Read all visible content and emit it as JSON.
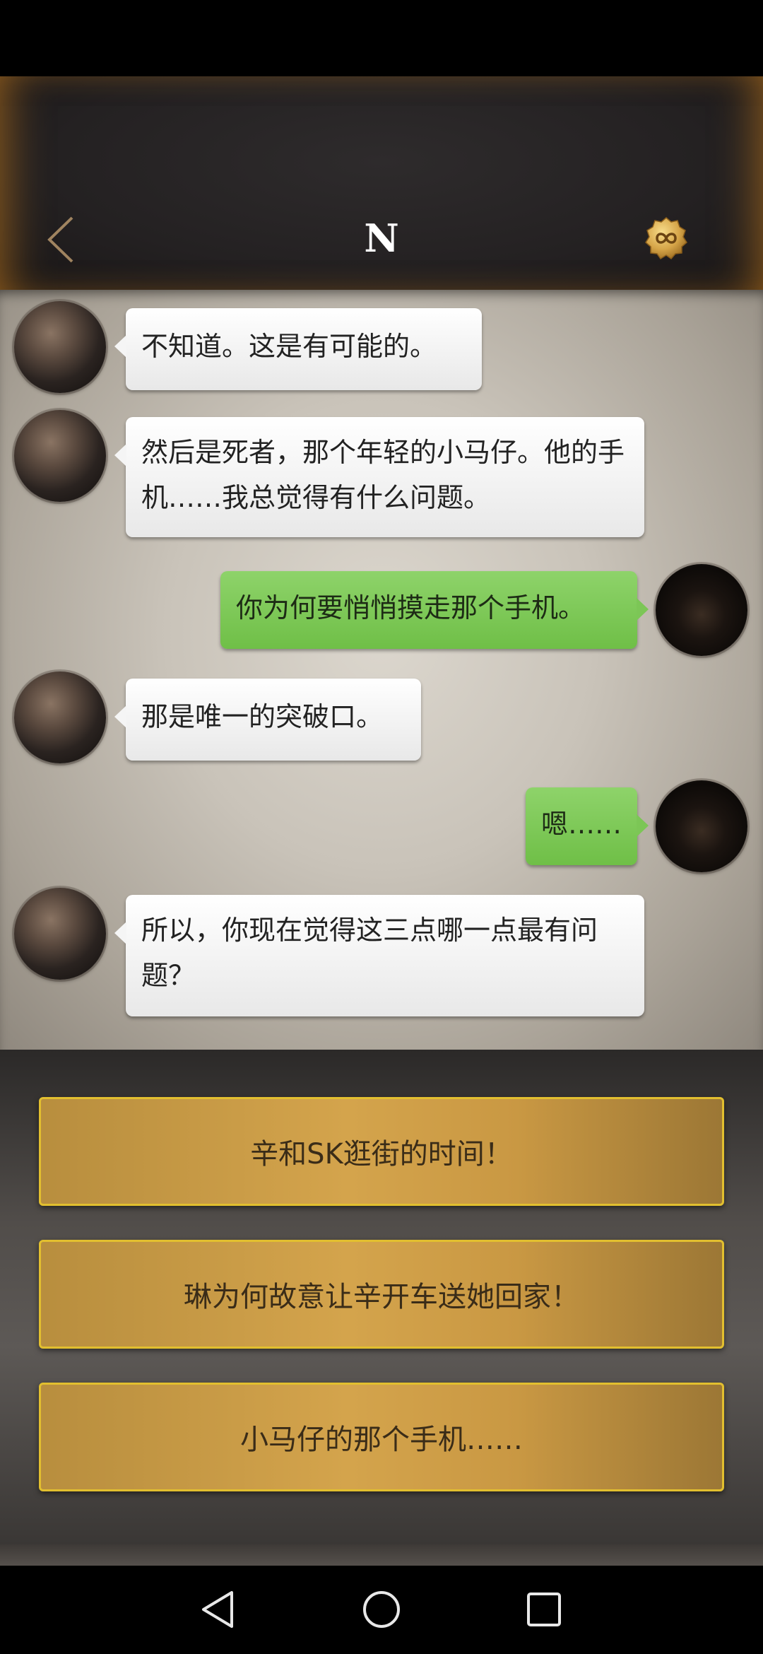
{
  "header": {
    "title": "N",
    "back_icon": "chevron-left-icon",
    "hint_icon": "infinity-badge-icon",
    "accent_color": "#c8a06a"
  },
  "messages": [
    {
      "sender": "npc",
      "text": "不知道。这是有可能的。"
    },
    {
      "sender": "npc",
      "text": "然后是死者，那个年轻的小马仔。他的手机……我总觉得有什么问题。"
    },
    {
      "sender": "player",
      "text": "你为何要悄悄摸走那个手机。"
    },
    {
      "sender": "npc",
      "text": "那是唯一的突破口。"
    },
    {
      "sender": "player",
      "text": "嗯……"
    },
    {
      "sender": "npc",
      "text": "所以，你现在觉得这三点哪一点最有问题？"
    }
  ],
  "options": [
    {
      "label": "辛和SK逛街的时间！"
    },
    {
      "label": "琳为何故意让辛开车送她回家！"
    },
    {
      "label": "小马仔的那个手机……"
    }
  ],
  "colors": {
    "npc_bubble": "#f2f2f2",
    "player_bubble": "#7cc656",
    "option_fill": "#d4a44c",
    "option_border": "#e2bf2f"
  },
  "nav": {
    "back_icon": "triangle-back-icon",
    "home_icon": "circle-home-icon",
    "recents_icon": "square-recents-icon"
  }
}
